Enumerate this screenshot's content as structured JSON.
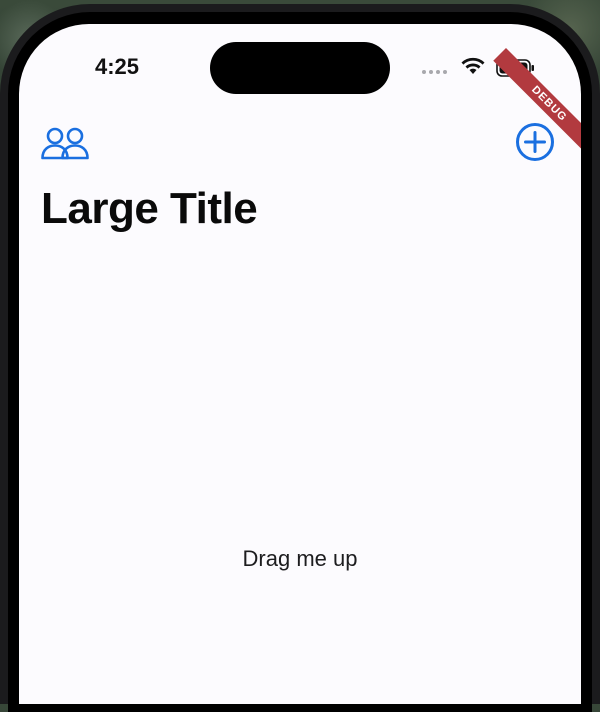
{
  "status_bar": {
    "time": "4:25",
    "icons": [
      "signal-dots-icon",
      "wifi-icon",
      "battery-icon"
    ]
  },
  "debug_banner": {
    "label": "DEBUG",
    "color": "#b23a3f"
  },
  "nav_bar": {
    "leading_icon": "people-icon",
    "trailing_icon": "plus-circle-icon",
    "accent_color": "#1a6fe0",
    "large_title": "Large Title"
  },
  "body": {
    "hint_text": "Drag me up"
  }
}
